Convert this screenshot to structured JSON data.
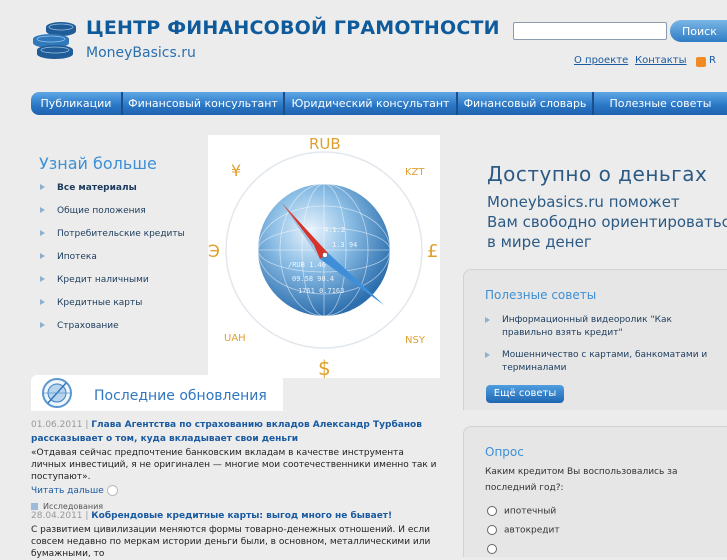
{
  "header": {
    "title": "ЦЕНТР ФИНАНСОВОЙ ГРАМОТНОСТИ",
    "subtitle": "MoneyBasics.ru",
    "search_placeholder": "",
    "search_button": "Поиск",
    "links": [
      "О проекте",
      "Контакты"
    ],
    "rss_label": "R"
  },
  "nav": {
    "items": [
      "Публикации",
      "Финансовый консультант",
      "Юридический консультант",
      "Финансовый словарь",
      "Полезные советы"
    ]
  },
  "sidebar": {
    "heading": "Узнай больше",
    "items": [
      "Все материалы",
      "Общие положения",
      "Потребительские кредиты",
      "Ипотека",
      "Кредит наличными",
      "Кредитные карты",
      "Страхование"
    ]
  },
  "globe": {
    "currencies": [
      "RUB",
      "KZT",
      "£",
      "NSY",
      "$",
      "UAH",
      "Э",
      "¥"
    ],
    "inner_text": [
      "/RUB 1.46",
      "09.58 98.4",
      "1761 0.7163",
      "4.1.2",
      "1.3 94"
    ]
  },
  "promo": {
    "title": "Доступно о деньгах",
    "lines": [
      "Moneybasics.ru поможет",
      "Вам свободно ориентироваться",
      "в мире денег"
    ]
  },
  "tips": {
    "title": "Полезные советы",
    "items": [
      "Информационный видеоролик \"Как правильно взять кредит\"",
      "Мошенничество с картами, банкоматами и терминалами"
    ],
    "more_button": "Ещё советы"
  },
  "poll": {
    "title": "Опрос",
    "question": "Каким кредитом Вы воспользовались за последний год?:",
    "options": [
      "ипотечный",
      "автокредит"
    ]
  },
  "updates": {
    "title": "Последние обновления",
    "news": [
      {
        "date": "01.06.2011",
        "sep": " | ",
        "title": "Глава Агентства по страхованию вкладов Александр Турбанов рассказывает о том, куда вкладывает свои деньги",
        "text": "«Отдавая сейчас предпочтение банковским вкладам в качестве инструмента личных инвестиций, я не оригинален — многие мои соотечественники именно так и поступают».",
        "read_more": "Читать дальше",
        "tag": "Исследования"
      },
      {
        "date": "28.04.2011",
        "sep": " | ",
        "title": "Кобрендовые кредитные карты: выгод много не бывает!",
        "text": "С развитием цивилизации меняются формы товарно-денежных отношений. И если совсем недавно по меркам истории деньги были, в основном, металлическими или бумажными, то"
      }
    ]
  },
  "colors": {
    "accent": "#2c79c7",
    "heading_blue": "#3d8fd6",
    "title_blue": "#0f5a9a",
    "background": "#ececec"
  }
}
